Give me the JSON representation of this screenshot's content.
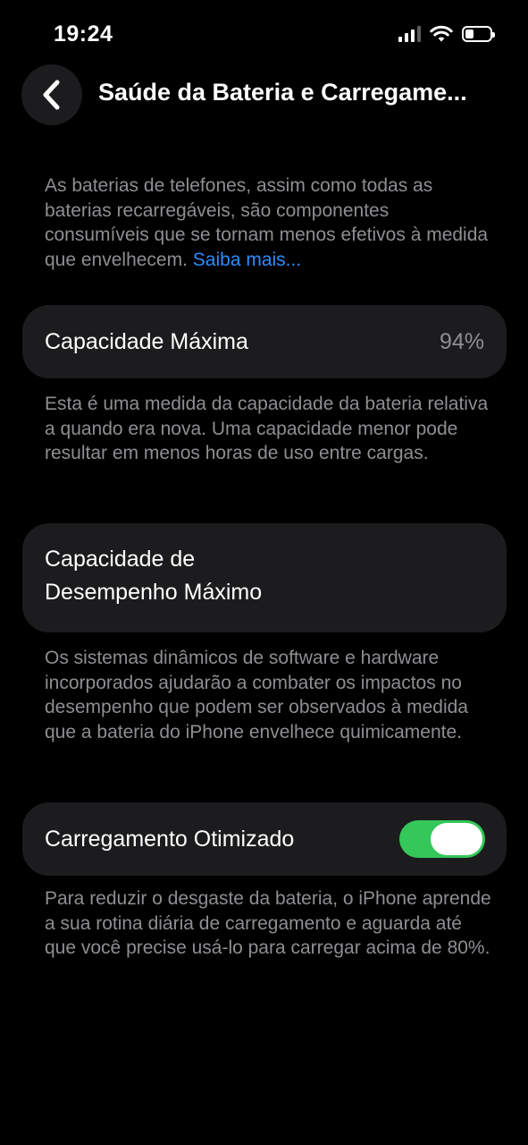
{
  "status_bar": {
    "time": "19:24",
    "signal_bars_active": 3,
    "signal_bars_total": 4,
    "wifi_icon": "wifi-icon",
    "battery_level": 0.35
  },
  "nav": {
    "back_icon": "chevron-left-icon",
    "title": "Saúde da Bateria e Carregame..."
  },
  "intro": {
    "text": "As baterias de telefones, assim como todas as baterias recarregáveis, são componentes consumíveis que se tornam menos efetivos à medida que envelhecem.",
    "link": "Saiba mais..."
  },
  "max_capacity": {
    "label": "Capacidade Máxima",
    "value": "94%",
    "description": "Esta é uma medida da capacidade da bateria relativa a quando era nova. Uma capacidade menor pode resultar em menos horas de uso entre cargas."
  },
  "peak_performance": {
    "label_line1": "Capacidade de",
    "label_line2": "Desempenho Máximo",
    "description": "Os sistemas dinâmicos de software e hardware incorporados ajudarão a combater os impactos no desempenho que podem ser observados à medida que a bateria do iPhone envelhece quimicamente."
  },
  "optimized_charging": {
    "label": "Carregamento Otimizado",
    "enabled": true,
    "toggle_color": "#34c759",
    "description": "Para reduzir o desgaste da bateria, o iPhone aprende a sua rotina diária de carregamento e aguarda até que você precise usá-lo para carregar acima de 80%."
  },
  "colors": {
    "background": "#000000",
    "card": "#1c1c1e",
    "secondary_text": "#8e8e93",
    "link": "#2f8cff"
  }
}
